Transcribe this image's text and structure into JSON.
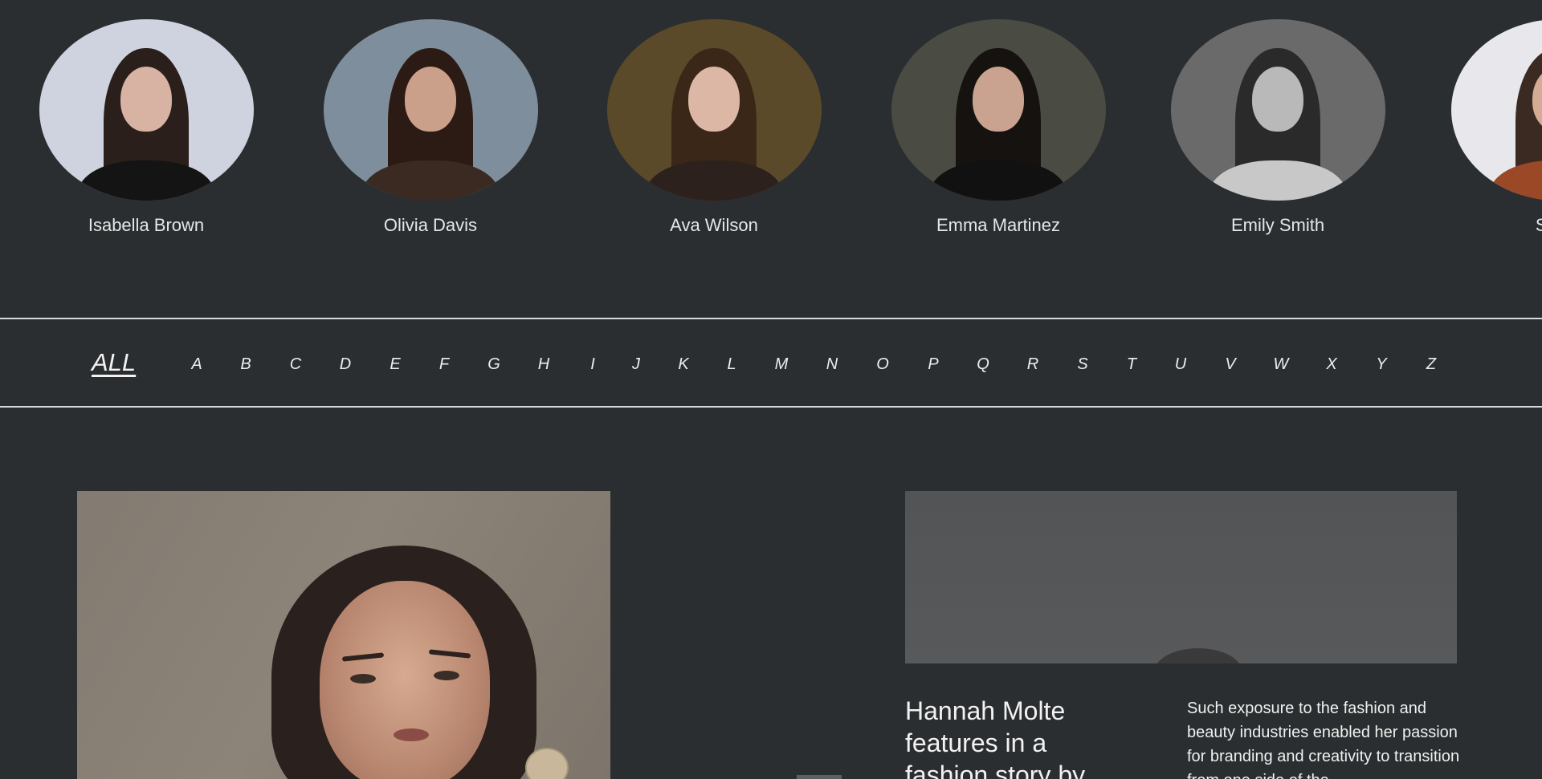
{
  "models": [
    {
      "name": "Isabella Brown",
      "colors": {
        "bg": "#cfd3e0",
        "hair": "#2a1f1b",
        "skin": "#d8b2a2",
        "body": "#141414"
      }
    },
    {
      "name": "Olivia Davis",
      "colors": {
        "bg": "#7f8e9c",
        "hair": "#2c1a14",
        "skin": "#caa08a",
        "body": "#3a2a22"
      }
    },
    {
      "name": "Ava Wilson",
      "colors": {
        "bg": "#5b4a2a",
        "hair": "#3a2718",
        "skin": "#dcb7a6",
        "body": "#2c211c"
      }
    },
    {
      "name": "Emma Martinez",
      "colors": {
        "bg": "#4a4c44",
        "hair": "#16120f",
        "skin": "#c9a38f",
        "body": "#111111"
      }
    },
    {
      "name": "Emily Smith",
      "colors": {
        "bg": "#6a6a6a",
        "hair": "#2a2a2a",
        "skin": "#b9b9b9",
        "body": "#c8c8c8"
      }
    },
    {
      "name": "Sophi",
      "colors": {
        "bg": "#e8e8ec",
        "hair": "#3a2a22",
        "skin": "#d2ac94",
        "body": "#9a4826"
      }
    }
  ],
  "filter": {
    "all_label": "ALL",
    "letters": [
      "A",
      "B",
      "C",
      "D",
      "E",
      "F",
      "G",
      "H",
      "I",
      "J",
      "K",
      "L",
      "M",
      "N",
      "O",
      "P",
      "Q",
      "R",
      "S",
      "T",
      "U",
      "V",
      "W",
      "X",
      "Y",
      "Z"
    ]
  },
  "featured": {
    "title": "Hannah Molte features in a fashion story by",
    "excerpt": "Such exposure to the fashion and beauty industries enabled her passion for branding and creativity to transition from one side of the"
  },
  "theme": {
    "background": "#2b2e30",
    "divider": "#d9d9d9",
    "text": "#e8e8e8"
  }
}
